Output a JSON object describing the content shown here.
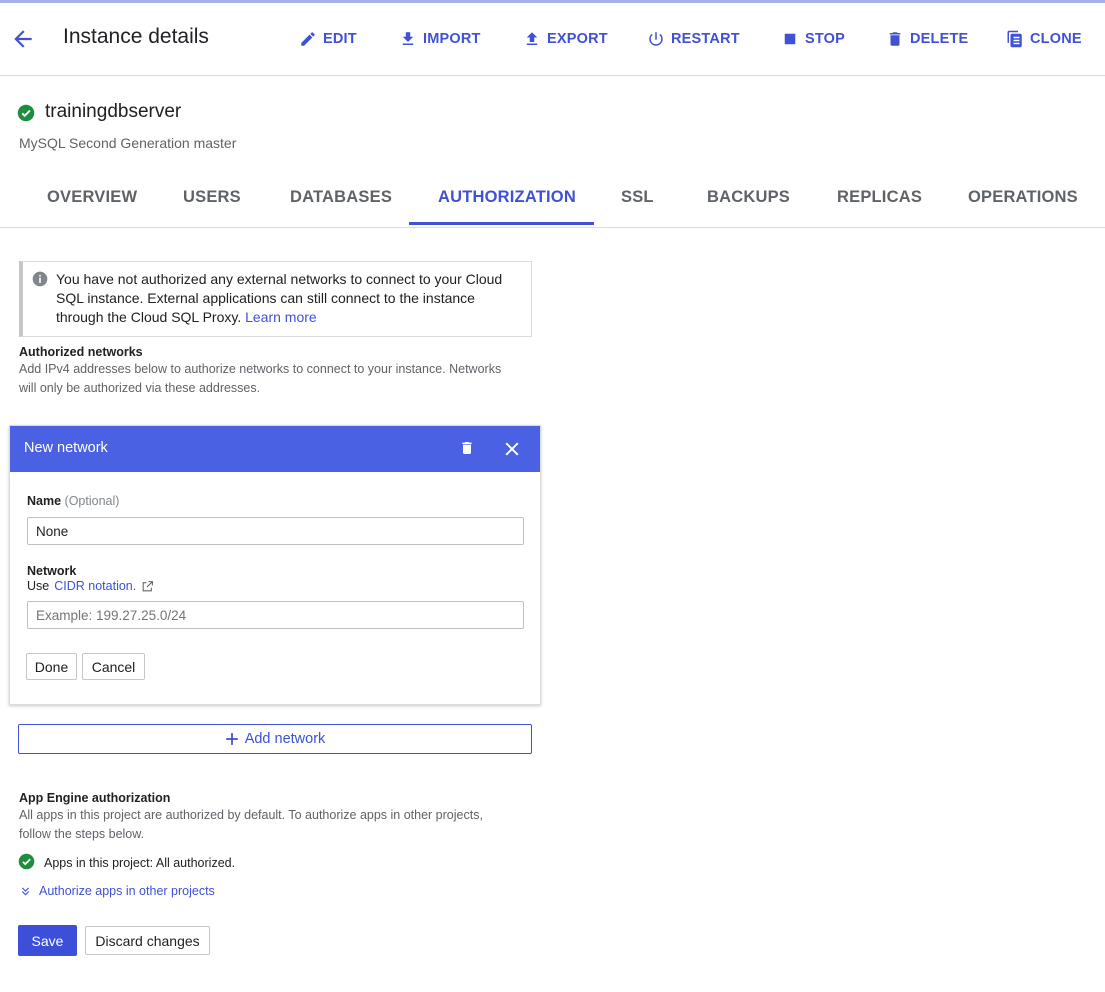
{
  "header": {
    "title": "Instance details",
    "actions": {
      "edit": "EDIT",
      "import": "IMPORT",
      "export": "EXPORT",
      "restart": "RESTART",
      "stop": "STOP",
      "delete": "DELETE",
      "clone": "CLONE"
    }
  },
  "instance": {
    "name": "trainingdbserver",
    "subtitle": "MySQL Second Generation master",
    "status_icon": "check-circle-icon"
  },
  "tabs": [
    "OVERVIEW",
    "USERS",
    "DATABASES",
    "AUTHORIZATION",
    "SSL",
    "BACKUPS",
    "REPLICAS",
    "OPERATIONS"
  ],
  "active_tab": "AUTHORIZATION",
  "info_banner": {
    "text": "You have not authorized any external networks to connect to your Cloud SQL instance. External applications can still connect to the instance through the Cloud SQL Proxy.",
    "link": "Learn more"
  },
  "authorized_networks": {
    "heading": "Authorized networks",
    "description": "Add IPv4 addresses below to authorize networks to connect to your instance. Networks will only be authorized via these addresses."
  },
  "new_network": {
    "title": "New network",
    "name_label": "Name",
    "name_optional": "(Optional)",
    "name_value": "None",
    "network_label": "Network",
    "network_hint_prefix": "Use",
    "network_hint_link": "CIDR notation.",
    "network_placeholder": "Example: 199.27.25.0/24",
    "done": "Done",
    "cancel": "Cancel"
  },
  "add_network": "Add network",
  "app_engine": {
    "heading": "App Engine authorization",
    "description": "All apps in this project are authorized by default. To authorize apps in other projects, follow the steps below.",
    "status": "Apps in this project: All authorized.",
    "expand_link": "Authorize apps in other projects"
  },
  "footer": {
    "save": "Save",
    "discard": "Discard changes"
  },
  "colors": {
    "accent": "#3f51d5",
    "card_header": "#4a61e3",
    "success": "#1e8e3e"
  }
}
